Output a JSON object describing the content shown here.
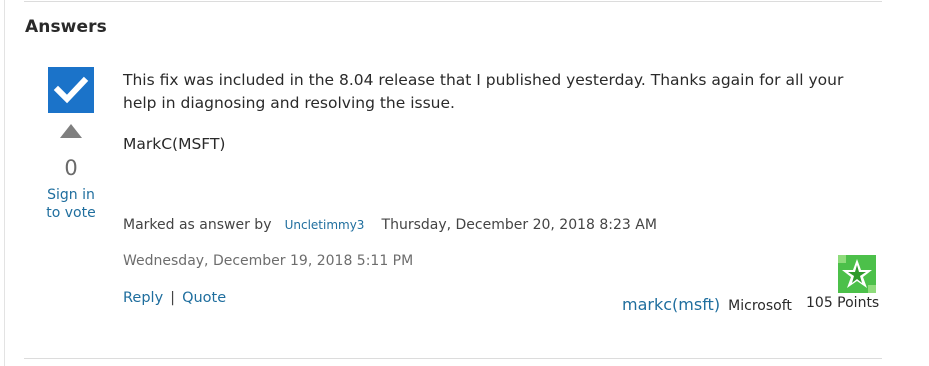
{
  "section": {
    "title": "Answers"
  },
  "answer": {
    "vote_count": "0",
    "sign_in_line1": "Sign in",
    "sign_in_line2": "to vote",
    "body": "This fix was included in the 8.04 release that I published yesterday. Thanks again for all your help in diagnosing and resolving the issue.",
    "signature": "MarkC(MSFT)",
    "marked_label": "Marked as answer by",
    "marked_by": "Uncletimmy3",
    "marked_date": "Thursday, December 20, 2018 8:23 AM",
    "post_date": "Wednesday, December 19, 2018 5:11 PM",
    "reply_label": "Reply",
    "separator": "|",
    "quote_label": "Quote"
  },
  "author": {
    "name": "markc(msft)",
    "organization": "Microsoft",
    "points": "105 Points",
    "badge_color": "#4cc04a"
  },
  "colors": {
    "accent_blue": "#1b73c9",
    "link": "#1f6e9e"
  },
  "icons": {
    "answer": "checkmark-icon",
    "vote": "vote-up-arrow-icon",
    "badge": "user-badge-icon"
  }
}
